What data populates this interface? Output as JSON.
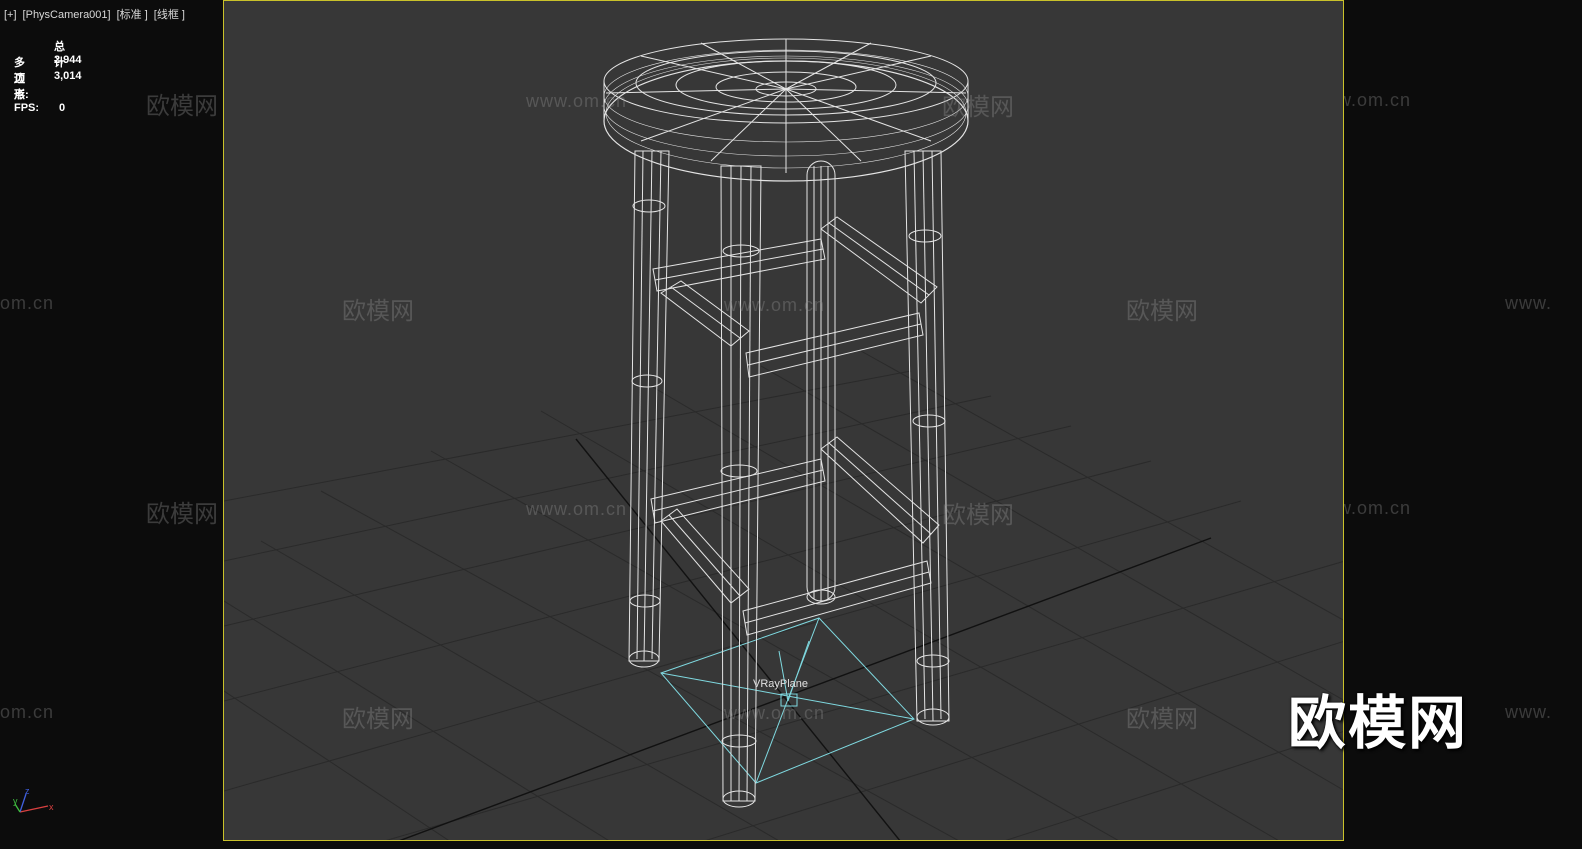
{
  "viewport_label": {
    "plus": "[+]",
    "camera": "[PhysCamera001]",
    "mode": "[标准 ]",
    "shading": "[线框 ]"
  },
  "stats": {
    "header": "总计",
    "polygons_label": "多边形:",
    "polygons_value": "2,944",
    "vertices_label": "顶点:",
    "vertices_value": "3,014",
    "fps_label": "FPS:",
    "fps_value": "0"
  },
  "scene": {
    "object_label": "VRayPlane",
    "wireframe_color": "#e8e8e8",
    "plane_color": "#7fd9e0",
    "viewport_border_color": "#c9c12a"
  },
  "watermarks": {
    "cn": "欧模网",
    "url": "www.om.cn",
    "url_partial": "om.cn",
    "www_partial": "www."
  },
  "brand_logo": "欧模网",
  "gizmo": {
    "x": "x",
    "y": "y",
    "z": "z"
  }
}
